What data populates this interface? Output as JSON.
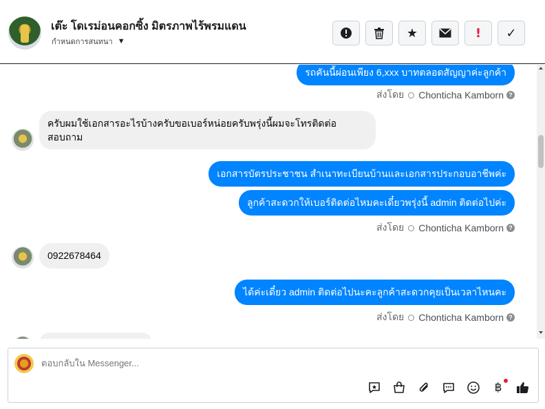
{
  "header": {
    "contact_name": "เต๊ะ โดเรม่อนคอกซิ้ง มิตรภาพไร้พรมแดน",
    "assign_label": "กำหนดการสนทนา",
    "actions": [
      {
        "icon": "alert-circle-icon",
        "glyph": "⓿"
      },
      {
        "icon": "trash-icon",
        "glyph": "🗑"
      },
      {
        "icon": "star-icon",
        "glyph": "★"
      },
      {
        "icon": "envelope-icon",
        "glyph": "✉"
      },
      {
        "icon": "exclamation-icon",
        "glyph": "!"
      },
      {
        "icon": "checkmark-icon",
        "glyph": "✓"
      }
    ]
  },
  "messages": {
    "m1": "รถคันนี้ผ่อนเพียง 6,xxx บาทตลอดสัญญาค่ะลูกค้า",
    "sent_by_prefix": "ส่งโดย",
    "agent_name": "Chonticha Kamborn",
    "m2_line1": "ครับผมใช้เอกสารอะไรบ้างครับขอเบอร์หน่อยครับพรุ่งนี้ผมจะโทรติดต่อ",
    "m2_line2": "สอบถาม",
    "m3": "เอกสารบัตรประชาชน สำเนาทะเบียนบ้านและเอกสารประกอบอาชีพค่ะ",
    "m4": "ลูกค้าสะดวกให้เบอร์ติดต่อไหมคะเดี๋ยวพรุ่งนี้ admin ติดต่อไปค่ะ",
    "m5": "0922678464",
    "m6": "ได้ค่ะเดี๋ยว admin ติดต่อไปนะคะลูกค้าสะดวกคุยเป็นเวลาไหนคะ"
  },
  "composer": {
    "placeholder": "ตอบกลับใน Messenger...",
    "tools": [
      "saved-reply-icon",
      "shop-bag-icon",
      "paperclip-icon",
      "chat-bubble-icon",
      "emoji-icon",
      "baht-icon",
      "thumbs-up-icon"
    ]
  },
  "colors": {
    "outgoing": "#0084ff",
    "incoming": "#f0f0f0",
    "alert": "#e41e3f"
  }
}
